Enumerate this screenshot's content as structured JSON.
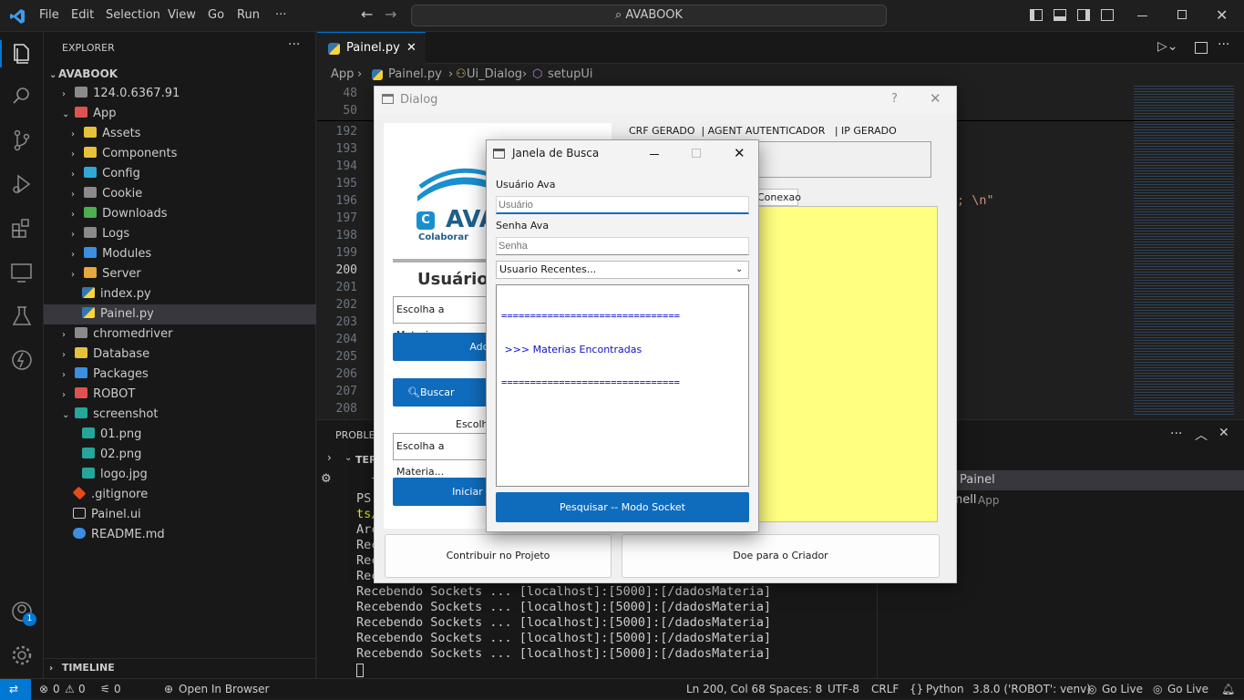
{
  "titlebar": {
    "menu": [
      "File",
      "Edit",
      "Selection",
      "View",
      "Go",
      "Run",
      "···"
    ],
    "search": "AVABOOK"
  },
  "sidebar": {
    "header": "EXPLORER",
    "root": "AVABOOK",
    "items": [
      {
        "label": "124.0.6367.91",
        "type": "folder"
      },
      {
        "label": "App",
        "type": "folder-open"
      },
      {
        "label": "Assets",
        "type": "folder"
      },
      {
        "label": "Components",
        "type": "folder"
      },
      {
        "label": "Config",
        "type": "folder"
      },
      {
        "label": "Cookie",
        "type": "folder"
      },
      {
        "label": "Downloads",
        "type": "folder"
      },
      {
        "label": "Logs",
        "type": "folder"
      },
      {
        "label": "Modules",
        "type": "folder"
      },
      {
        "label": "Server",
        "type": "folder"
      },
      {
        "label": "index.py",
        "type": "python"
      },
      {
        "label": "Painel.py",
        "type": "python"
      },
      {
        "label": "chromedriver",
        "type": "folder"
      },
      {
        "label": "Database",
        "type": "folder"
      },
      {
        "label": "Packages",
        "type": "folder"
      },
      {
        "label": "ROBOT",
        "type": "folder"
      },
      {
        "label": "screenshot",
        "type": "folder-open"
      },
      {
        "label": "01.png",
        "type": "image"
      },
      {
        "label": "02.png",
        "type": "image"
      },
      {
        "label": "logo.jpg",
        "type": "image"
      },
      {
        "label": ".gitignore",
        "type": "git"
      },
      {
        "label": "Painel.ui",
        "type": "file"
      },
      {
        "label": "README.md",
        "type": "info"
      }
    ],
    "timeline": "TIMELINE"
  },
  "editor": {
    "tab": "Painel.py",
    "breadcrumbs": [
      "App",
      "Painel.py",
      "Ui_Dialog",
      "setupUi"
    ],
    "line_numbers_top": [
      "48",
      "50"
    ],
    "line_numbers": [
      "192",
      "193",
      "194",
      "195",
      "196",
      "197",
      "198",
      "199",
      "200",
      "201",
      "202",
      "203",
      "204",
      "205",
      "206",
      "207",
      "208"
    ],
    "code_fragment": "; \\n\""
  },
  "panel": {
    "tab_problems": "PROBLEM",
    "terminal_label": "TER",
    "terminal_lines": [
      "  li",
      "PS",
      "ts/",
      "Arc",
      "Rece",
      "Rece",
      "Rece",
      "Recebendo Sockets ... [localhost]:[5000]:[/dadosMateria]",
      "Recebendo Sockets ... [localhost]:[5000]:[/dadosMateria]",
      "Recebendo Sockets ... [localhost]:[5000]:[/dadosMateria]",
      "Recebendo Sockets ... [localhost]:[5000]:[/dadosMateria]",
      "Recebendo Sockets ... [localhost]:[5000]:[/dadosMateria]"
    ],
    "term_list": [
      {
        "label": "Painel",
        "sub": ""
      },
      {
        "label": "nell",
        "sub": "App"
      }
    ]
  },
  "dialog": {
    "title": "Dialog",
    "help": "?",
    "header_text": "CRF GERADO  | AGENT AUTENTICADOR   | IP GERADO",
    "logo_text": "AVA",
    "logo_sub": "Colaborar",
    "usuarios_title": "Usuários",
    "combo1": "Escolha a Materia...",
    "add_button": "Add",
    "buscar_button": "Buscar Materia",
    "escolha_label": "Escolhe",
    "combo2": "Escolha a Materia...",
    "iniciar_button": "Iniciar T",
    "tab_conexao": "Conexao",
    "contribuir_button": "Contribuir no Projeto",
    "doe_button": "Doe para o Criador"
  },
  "busca": {
    "title": "Janela de Busca",
    "usuario_label": "Usuário Ava",
    "usuario_placeholder": "Usuário",
    "senha_label": "Senha Ava",
    "senha_placeholder": "Senha",
    "recentes": "Usuario Recentes...",
    "output_line1": "===============================",
    "output_line2": " >>> Materias Encontradas",
    "output_line3": "===============================",
    "search_button": "Pesquisar -- Modo Socket"
  },
  "status": {
    "errors": "0",
    "warnings": "0",
    "ports": "0",
    "open_browser": "Open In Browser",
    "position": "Ln 200, Col 68",
    "spaces": "Spaces: 8",
    "encoding": "UTF-8",
    "eol": "CRLF",
    "language": "Python",
    "interpreter": "3.8.0 ('ROBOT': venv)",
    "golive1": "Go Live",
    "golive2": "Go Live",
    "account_badge": "1"
  },
  "colors": {
    "accent": "#0078d4",
    "qt_button": "#0f6cbd",
    "log_area": "#ffff80"
  }
}
